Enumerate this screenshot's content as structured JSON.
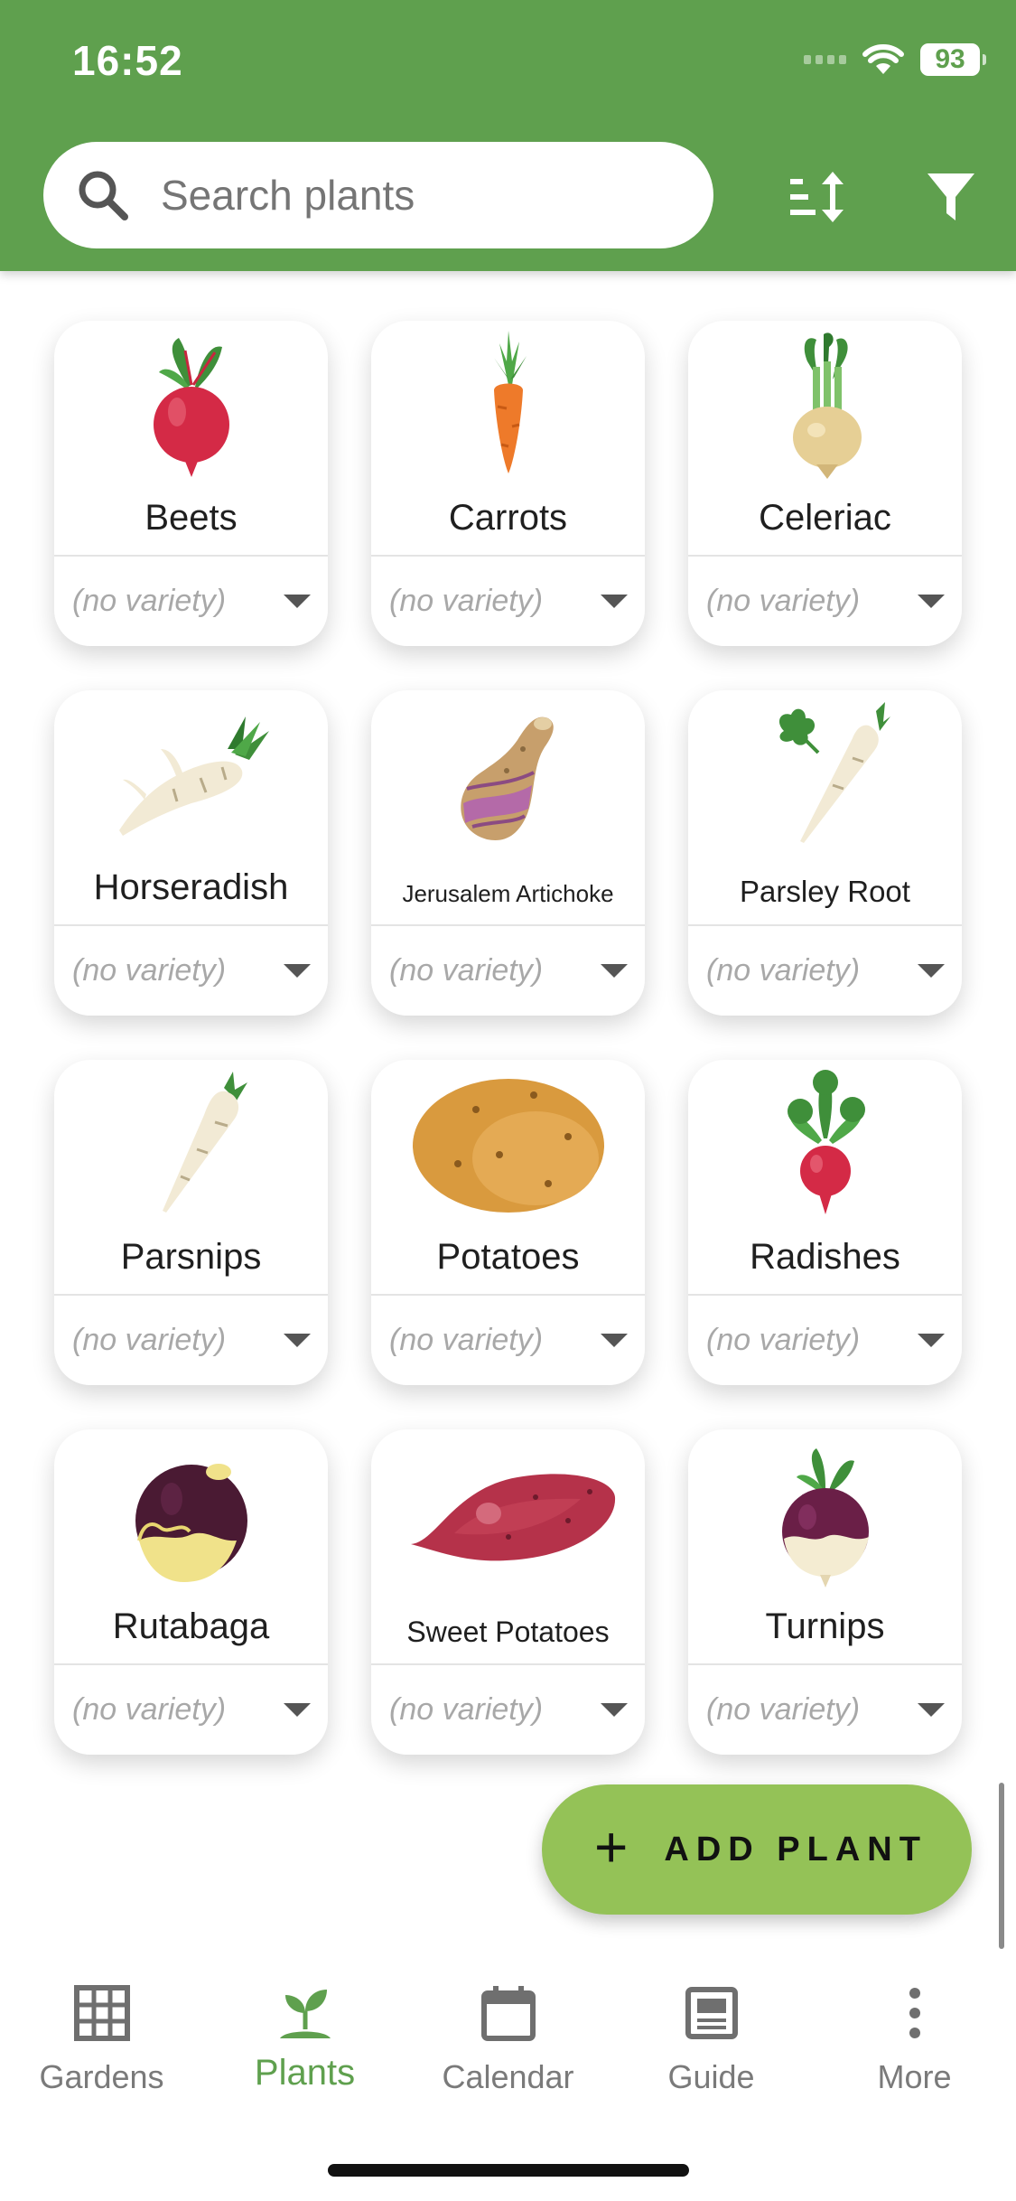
{
  "status_bar": {
    "time": "16:52",
    "battery": "93"
  },
  "search": {
    "placeholder": "Search plants"
  },
  "colors": {
    "header": "#5fa04e",
    "fab": "#94c257",
    "active_nav": "#5fa04e"
  },
  "plants": [
    {
      "name": "Beets",
      "variety": "(no variety)",
      "icon": "beet-icon"
    },
    {
      "name": "Carrots",
      "variety": "(no variety)",
      "icon": "carrot-icon"
    },
    {
      "name": "Celeriac",
      "variety": "(no variety)",
      "icon": "celeriac-icon"
    },
    {
      "name": "Horseradish",
      "variety": "(no variety)",
      "icon": "horseradish-icon"
    },
    {
      "name": "Jerusalem Artichoke",
      "variety": "(no variety)",
      "icon": "jerusalem-artichoke-icon"
    },
    {
      "name": "Parsley Root",
      "variety": "(no variety)",
      "icon": "parsley-root-icon"
    },
    {
      "name": "Parsnips",
      "variety": "(no variety)",
      "icon": "parsnip-icon"
    },
    {
      "name": "Potatoes",
      "variety": "(no variety)",
      "icon": "potato-icon"
    },
    {
      "name": "Radishes",
      "variety": "(no variety)",
      "icon": "radish-icon"
    },
    {
      "name": "Rutabaga",
      "variety": "(no variety)",
      "icon": "rutabaga-icon"
    },
    {
      "name": "Sweet Potatoes",
      "variety": "(no variety)",
      "icon": "sweet-potato-icon"
    },
    {
      "name": "Turnips",
      "variety": "(no variety)",
      "icon": "turnip-icon"
    }
  ],
  "fab": {
    "label": "ADD PLANT",
    "icon": "plus-icon"
  },
  "bottom_nav": [
    {
      "label": "Gardens",
      "icon": "grid-icon",
      "active": false
    },
    {
      "label": "Plants",
      "icon": "sprout-icon",
      "active": true
    },
    {
      "label": "Calendar",
      "icon": "calendar-icon",
      "active": false
    },
    {
      "label": "Guide",
      "icon": "book-icon",
      "active": false
    },
    {
      "label": "More",
      "icon": "more-vertical-icon",
      "active": false
    }
  ]
}
